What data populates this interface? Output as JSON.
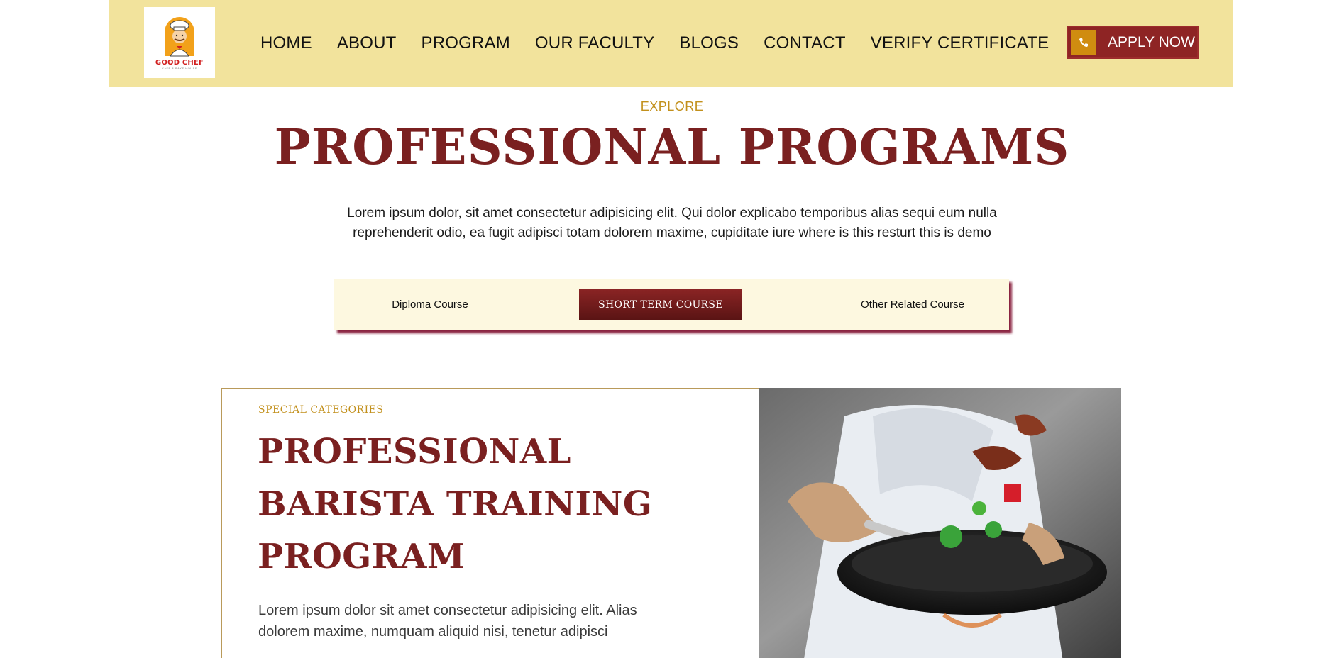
{
  "header": {
    "logo": {
      "name": "GOOD CHEF",
      "tagline": "CAFE & BAKE HOUSE"
    },
    "nav": [
      "HOME",
      "ABOUT",
      "PROGRAM",
      "OUR FACULTY",
      "BLOGS",
      "CONTACT",
      "VERIFY CERTIFICATE"
    ],
    "apply_label": "APPLY NOW",
    "apply_icon": "phone-icon"
  },
  "hero": {
    "eyebrow": "EXPLORE",
    "title": "PROFESSIONAL PROGRAMS",
    "intro": "Lorem ipsum dolor, sit amet consectetur adipisicing elit. Qui dolor explicabo temporibus alias sequi eum nulla reprehenderit odio, ea fugit adipisci totam dolorem maxime, cupiditate iure where is this resturt this is demo"
  },
  "tabs": {
    "items": [
      "Diploma Course",
      "SHORT TERM COURSE",
      "Other Related Course"
    ],
    "active": "SHORT TERM COURSE"
  },
  "program": {
    "category": "SPECIAL CATEGORIES",
    "title": "PROFESSIONAL BARISTA TRAINING PROGRAM",
    "description": "Lorem ipsum dolor sit amet consectetur adipisicing elit. Alias dolorem maxime, numquam aliquid nisi, tenetur adipisci"
  },
  "colors": {
    "header_bg": "#f2e39c",
    "brand_maroon": "#7a2020",
    "accent_gold": "#c2901c",
    "tab_bar_bg": "#fdf8e0"
  }
}
